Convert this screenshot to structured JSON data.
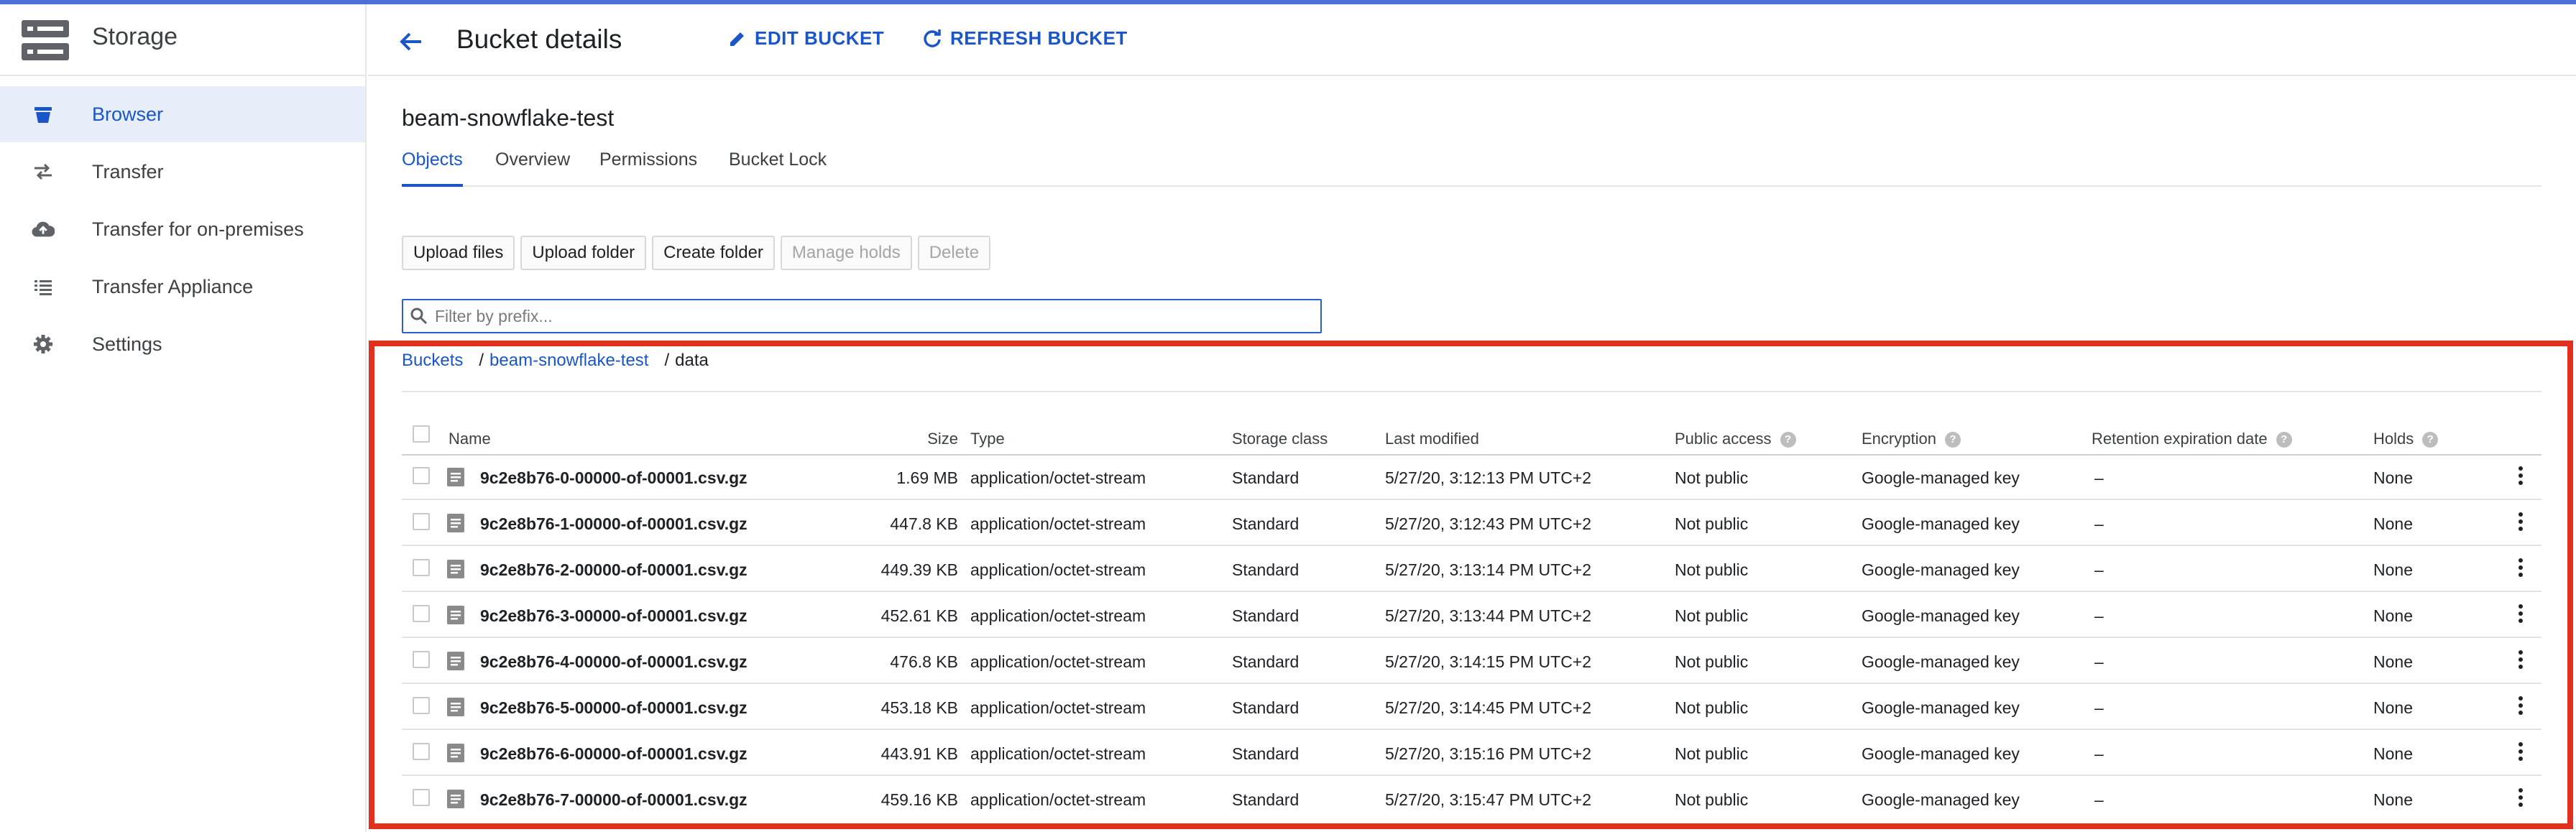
{
  "sidebar": {
    "title": "Storage",
    "items": [
      {
        "label": "Browser",
        "icon": "bucket-icon"
      },
      {
        "label": "Transfer",
        "icon": "transfer-arrows-icon"
      },
      {
        "label": "Transfer for on-premises",
        "icon": "cloud-upload-icon"
      },
      {
        "label": "Transfer Appliance",
        "icon": "list-icon"
      },
      {
        "label": "Settings",
        "icon": "gear-icon"
      }
    ]
  },
  "header": {
    "title": "Bucket details",
    "edit_label": "EDIT BUCKET",
    "refresh_label": "REFRESH BUCKET"
  },
  "bucket_name": "beam-snowflake-test",
  "tabs": [
    "Objects",
    "Overview",
    "Permissions",
    "Bucket Lock"
  ],
  "toolbar": {
    "upload_files": "Upload files",
    "upload_folder": "Upload folder",
    "create_folder": "Create folder",
    "manage_holds": "Manage holds",
    "delete": "Delete"
  },
  "filter": {
    "placeholder": "Filter by prefix..."
  },
  "breadcrumb": {
    "root": "Buckets",
    "sep": "/",
    "bucket": "beam-snowflake-test",
    "folder": "data"
  },
  "table": {
    "columns": {
      "name": "Name",
      "size": "Size",
      "type": "Type",
      "storage_class": "Storage class",
      "last_modified": "Last modified",
      "public_access": "Public access",
      "encryption": "Encryption",
      "retention": "Retention expiration date",
      "holds": "Holds"
    },
    "rows": [
      {
        "name": "9c2e8b76-0-00000-of-00001.csv.gz",
        "size": "1.69 MB",
        "type": "application/octet-stream",
        "storage_class": "Standard",
        "last_modified": "5/27/20, 3:12:13 PM UTC+2",
        "public_access": "Not public",
        "encryption": "Google-managed key",
        "retention": "–",
        "holds": "None"
      },
      {
        "name": "9c2e8b76-1-00000-of-00001.csv.gz",
        "size": "447.8 KB",
        "type": "application/octet-stream",
        "storage_class": "Standard",
        "last_modified": "5/27/20, 3:12:43 PM UTC+2",
        "public_access": "Not public",
        "encryption": "Google-managed key",
        "retention": "–",
        "holds": "None"
      },
      {
        "name": "9c2e8b76-2-00000-of-00001.csv.gz",
        "size": "449.39 KB",
        "type": "application/octet-stream",
        "storage_class": "Standard",
        "last_modified": "5/27/20, 3:13:14 PM UTC+2",
        "public_access": "Not public",
        "encryption": "Google-managed key",
        "retention": "–",
        "holds": "None"
      },
      {
        "name": "9c2e8b76-3-00000-of-00001.csv.gz",
        "size": "452.61 KB",
        "type": "application/octet-stream",
        "storage_class": "Standard",
        "last_modified": "5/27/20, 3:13:44 PM UTC+2",
        "public_access": "Not public",
        "encryption": "Google-managed key",
        "retention": "–",
        "holds": "None"
      },
      {
        "name": "9c2e8b76-4-00000-of-00001.csv.gz",
        "size": "476.8 KB",
        "type": "application/octet-stream",
        "storage_class": "Standard",
        "last_modified": "5/27/20, 3:14:15 PM UTC+2",
        "public_access": "Not public",
        "encryption": "Google-managed key",
        "retention": "–",
        "holds": "None"
      },
      {
        "name": "9c2e8b76-5-00000-of-00001.csv.gz",
        "size": "453.18 KB",
        "type": "application/octet-stream",
        "storage_class": "Standard",
        "last_modified": "5/27/20, 3:14:45 PM UTC+2",
        "public_access": "Not public",
        "encryption": "Google-managed key",
        "retention": "–",
        "holds": "None"
      },
      {
        "name": "9c2e8b76-6-00000-of-00001.csv.gz",
        "size": "443.91 KB",
        "type": "application/octet-stream",
        "storage_class": "Standard",
        "last_modified": "5/27/20, 3:15:16 PM UTC+2",
        "public_access": "Not public",
        "encryption": "Google-managed key",
        "retention": "–",
        "holds": "None"
      },
      {
        "name": "9c2e8b76-7-00000-of-00001.csv.gz",
        "size": "459.16 KB",
        "type": "application/octet-stream",
        "storage_class": "Standard",
        "last_modified": "5/27/20, 3:15:47 PM UTC+2",
        "public_access": "Not public",
        "encryption": "Google-managed key",
        "retention": "–",
        "holds": "None"
      }
    ]
  },
  "colors": {
    "accent": "#1a56c8",
    "highlight_box": "#e2301f",
    "top_bar": "#4a6fd6",
    "active_nav_bg": "#e8eef9"
  }
}
